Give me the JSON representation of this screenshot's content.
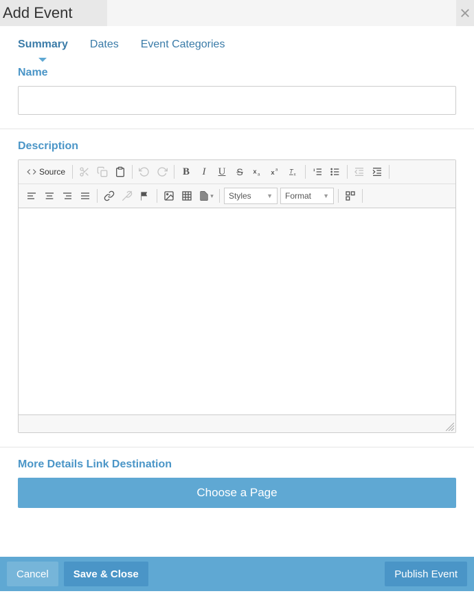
{
  "header": {
    "title": "Add Event"
  },
  "tabs": [
    {
      "label": "Summary",
      "active": true
    },
    {
      "label": "Dates",
      "active": false
    },
    {
      "label": "Event Categories",
      "active": false
    }
  ],
  "name_field": {
    "label": "Name",
    "value": ""
  },
  "description_field": {
    "label": "Description",
    "toolbar": {
      "source_label": "Source",
      "styles_label": "Styles",
      "format_label": "Format"
    }
  },
  "more_details": {
    "label": "More Details Link Destination",
    "button_label": "Choose a Page"
  },
  "footer": {
    "cancel": "Cancel",
    "save": "Save & Close",
    "publish": "Publish Event"
  }
}
